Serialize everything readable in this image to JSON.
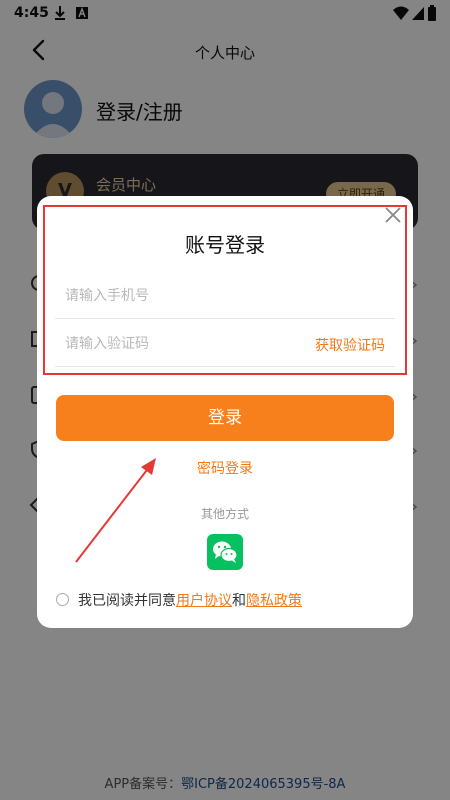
{
  "status_bar": {
    "time": "4:45"
  },
  "header": {
    "title": "个人中心"
  },
  "profile": {
    "login_register": "登录/注册"
  },
  "vip_card": {
    "title": "会员中心",
    "badge_letter": "V",
    "button": "立即开通"
  },
  "footer": {
    "label": "APP备案号：",
    "code": "鄂ICP备2024065395号-8A"
  },
  "dialog": {
    "title": "账号登录",
    "phone_placeholder": "请输入手机号",
    "code_placeholder": "请输入验证码",
    "get_code": "获取验证码",
    "login_button": "登录",
    "password_login": "密码登录",
    "other_methods": "其他方式",
    "agreement_prefix": "我已阅读并同意",
    "user_agreement": "用户协议",
    "agreement_and": "和",
    "privacy_policy": "隐私政策"
  },
  "colors": {
    "accent": "#f7801c",
    "link": "#f07a1a",
    "highlight": "#e53935",
    "wechat": "#07c160"
  },
  "icons": [
    "back-arrow-icon",
    "close-icon",
    "wechat-icon",
    "download-icon",
    "wifi-icon",
    "signal-icon",
    "battery-icon",
    "vip-badge-icon",
    "chevron-right-icon"
  ]
}
